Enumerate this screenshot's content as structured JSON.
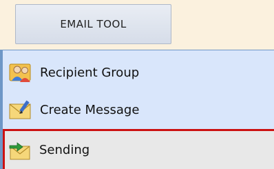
{
  "tab": {
    "label": "EMAIL TOOL"
  },
  "menu": {
    "items": [
      {
        "label": "Recipient Group",
        "icon": "group-users-icon"
      },
      {
        "label": "Create Message",
        "icon": "compose-envelope-icon"
      },
      {
        "label": "Sending",
        "icon": "send-envelope-icon",
        "selected": true
      }
    ]
  },
  "colors": {
    "top_band": "#fbf1de",
    "menu_bg": "#d9e6fb",
    "menu_border": "#6e97c7",
    "selected_bg": "#e8e8e8",
    "selected_border": "#cc1111"
  }
}
